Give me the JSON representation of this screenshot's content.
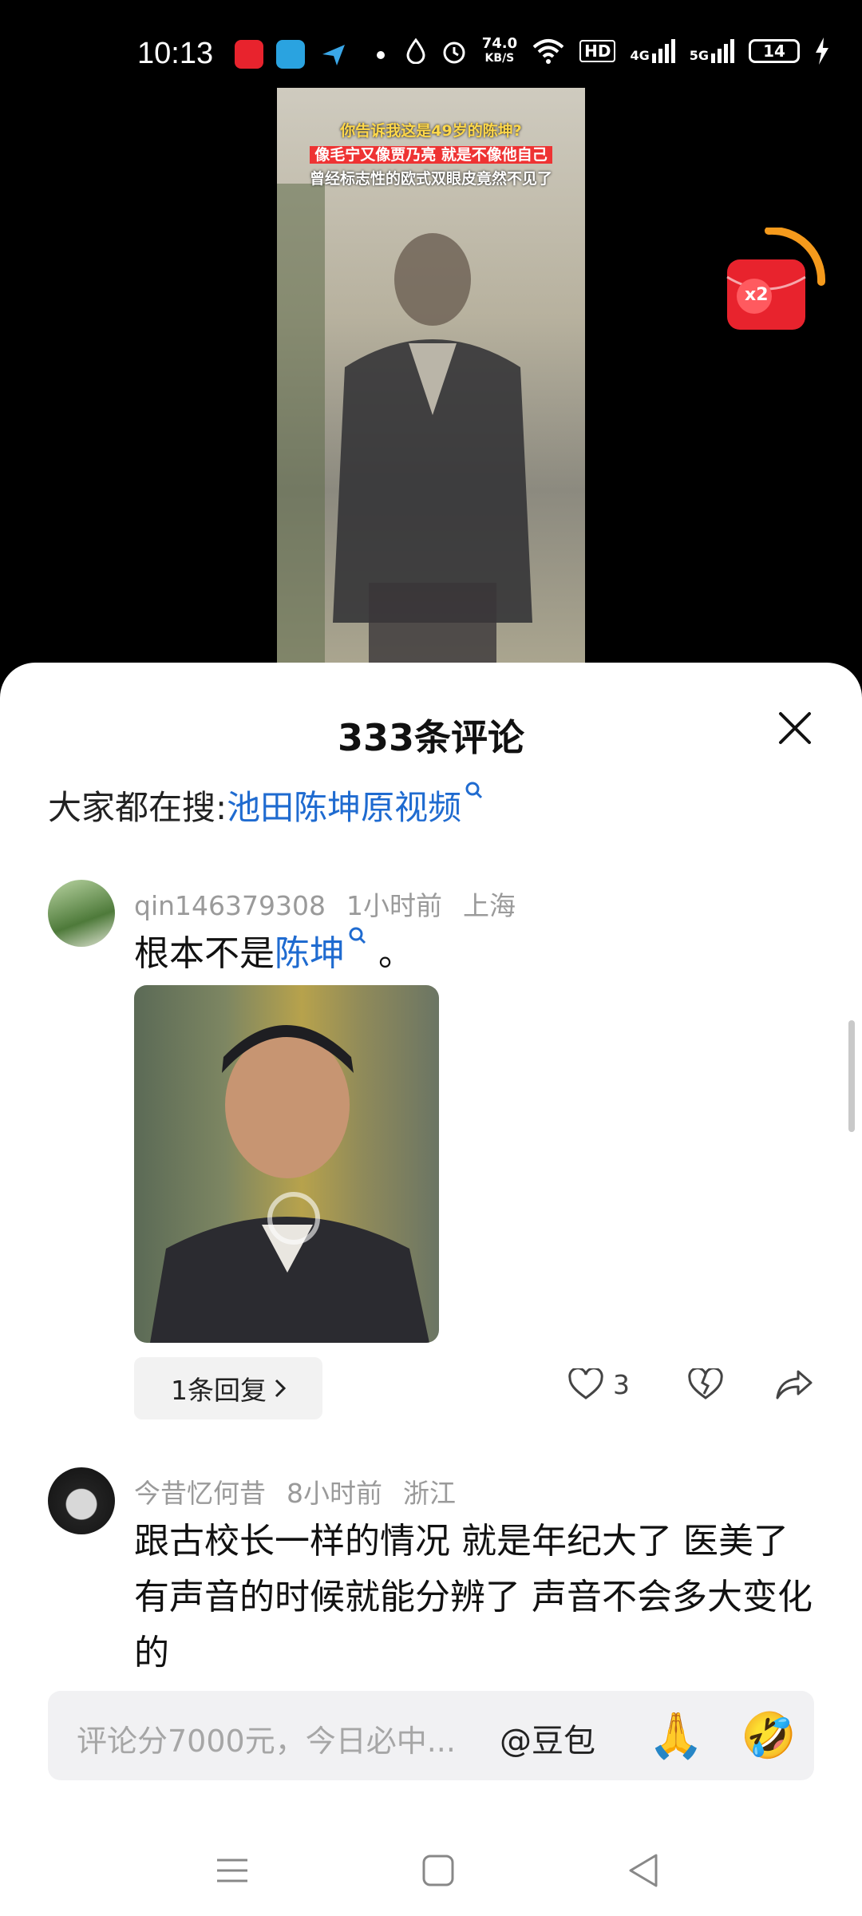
{
  "status_bar": {
    "time": "10:13",
    "net_speed_value": "74.0",
    "net_speed_unit": "KB/S",
    "hd_label": "HD",
    "sim1": "4G",
    "sim2": "5G",
    "battery": "14"
  },
  "video": {
    "caption_line1": "你告诉我这是49岁的陈坤?",
    "caption_line2": "像毛宁又像贾乃亮 就是不像他自己",
    "caption_line3": "曾经标志性的欧式双眼皮竟然不见了"
  },
  "red_packet": {
    "badge": "x2"
  },
  "sheet": {
    "title": "333条评论",
    "hot_search_prefix": "大家都在搜:",
    "hot_search_link": "池田陈坤原视频"
  },
  "comments": [
    {
      "user": "qin146379308",
      "time": "1小时前",
      "location": "上海",
      "text_before": "根本不是",
      "text_link": "陈坤",
      "text_after": " 。",
      "replies": "1条回复",
      "likes": "3"
    },
    {
      "user": "今昔忆何昔",
      "time": "8小时前",
      "location": "浙江",
      "text": "跟古校长一样的情况 就是年纪大了 医美了 有声音的时候就能分辨了 声音不会多大变化的"
    }
  ],
  "input_bar": {
    "placeholder": "评论分7000元，今日必中...",
    "mention": "@豆包",
    "emoji1": "🙏",
    "emoji2": "🤣"
  },
  "colors": {
    "link": "#1f6bd0",
    "red_packet": "#e8232d"
  }
}
